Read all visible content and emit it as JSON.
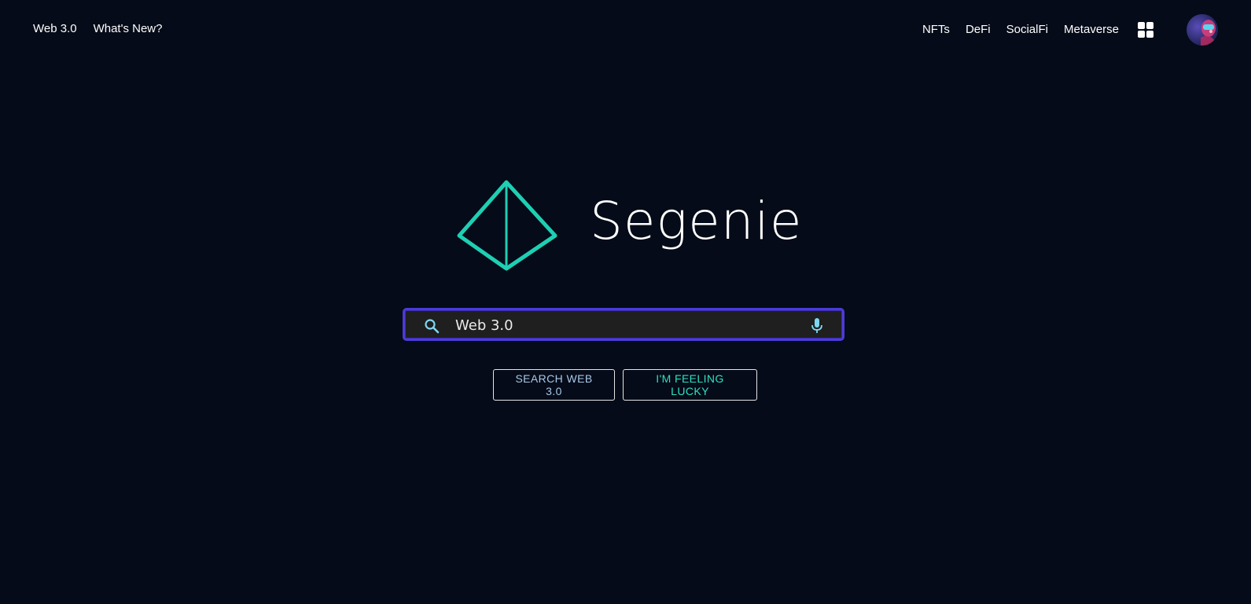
{
  "nav": {
    "left": [
      "Web 3.0",
      "What's New?"
    ],
    "right": [
      "NFTs",
      "DeFi",
      "SocialFi",
      "Metaverse"
    ],
    "apps_icon": "grid-apps-icon",
    "avatar_icon": "user-avatar"
  },
  "logo": {
    "text": "Segenie",
    "icon": "pyramid-logo-icon",
    "color": "#1ecfb3"
  },
  "search": {
    "value": "Web 3.0",
    "placeholder": "",
    "search_icon": "search-icon",
    "mic_icon": "microphone-icon",
    "border_color": "#4b3cd8"
  },
  "buttons": {
    "search_label": "SEARCH WEB 3.0",
    "lucky_label": "I'M FEELING LUCKY"
  },
  "colors": {
    "background": "#050b18",
    "accent": "#1ecfb3"
  }
}
